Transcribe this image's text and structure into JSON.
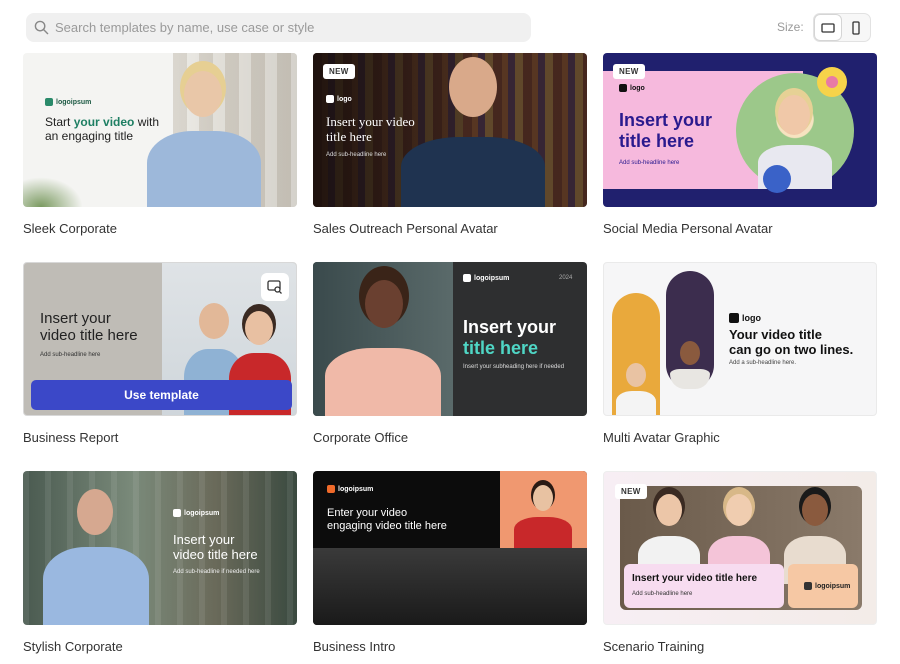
{
  "search": {
    "placeholder": "Search templates by name, use case or style"
  },
  "size": {
    "label": "Size:",
    "options": [
      "landscape",
      "portrait"
    ],
    "selected": "landscape"
  },
  "templates": [
    {
      "title": "Sleek Corporate",
      "logo": "logoipsum",
      "headline_a": "Start ",
      "headline_b": "your video",
      "headline_c": " with",
      "headline_d": "an engaging title"
    },
    {
      "title": "Sales Outreach Personal Avatar",
      "badge": "NEW",
      "logo": "logo",
      "headline_a": "Insert your video",
      "headline_b": "title here",
      "sub": "Add sub-headline here"
    },
    {
      "title": "Social Media Personal Avatar",
      "badge": "NEW",
      "logo": "logo",
      "headline_a": "Insert your",
      "headline_b": "title here",
      "sub": "Add sub-headline here"
    },
    {
      "title": "Business Report",
      "headline_a": "Insert your",
      "headline_b": "video title here",
      "sub": "Add sub-headline here",
      "cta": "Use template"
    },
    {
      "title": "Corporate Office",
      "logo": "logoipsum",
      "corner": "2024",
      "headline_a": "Insert your",
      "headline_b": "title here",
      "sub": "Insert your subheading here if needed"
    },
    {
      "title": "Multi Avatar Graphic",
      "logo": "logo",
      "headline_a": "Your video title",
      "headline_b": "can go on two lines.",
      "sub": "Add a sub-headline here."
    },
    {
      "title": "Stylish Corporate",
      "logo": "logoipsum",
      "headline_a": "Insert your",
      "headline_b": "video title here",
      "sub": "Add sub-headline if needed here"
    },
    {
      "title": "Business Intro",
      "logo": "logoipsum",
      "headline_a": "Enter your video",
      "headline_b": "engaging video title here"
    },
    {
      "title": "Scenario Training",
      "badge": "NEW",
      "logo": "logoipsum",
      "headline_a": "Insert your video title here",
      "sub": "Add sub-headline here"
    }
  ],
  "colors": {
    "cta": "#3b48c8",
    "teal": "#4fd6c5",
    "orange": "#f06a2a",
    "purple": "#2b1f8f",
    "pink": "#f5b8dc"
  }
}
